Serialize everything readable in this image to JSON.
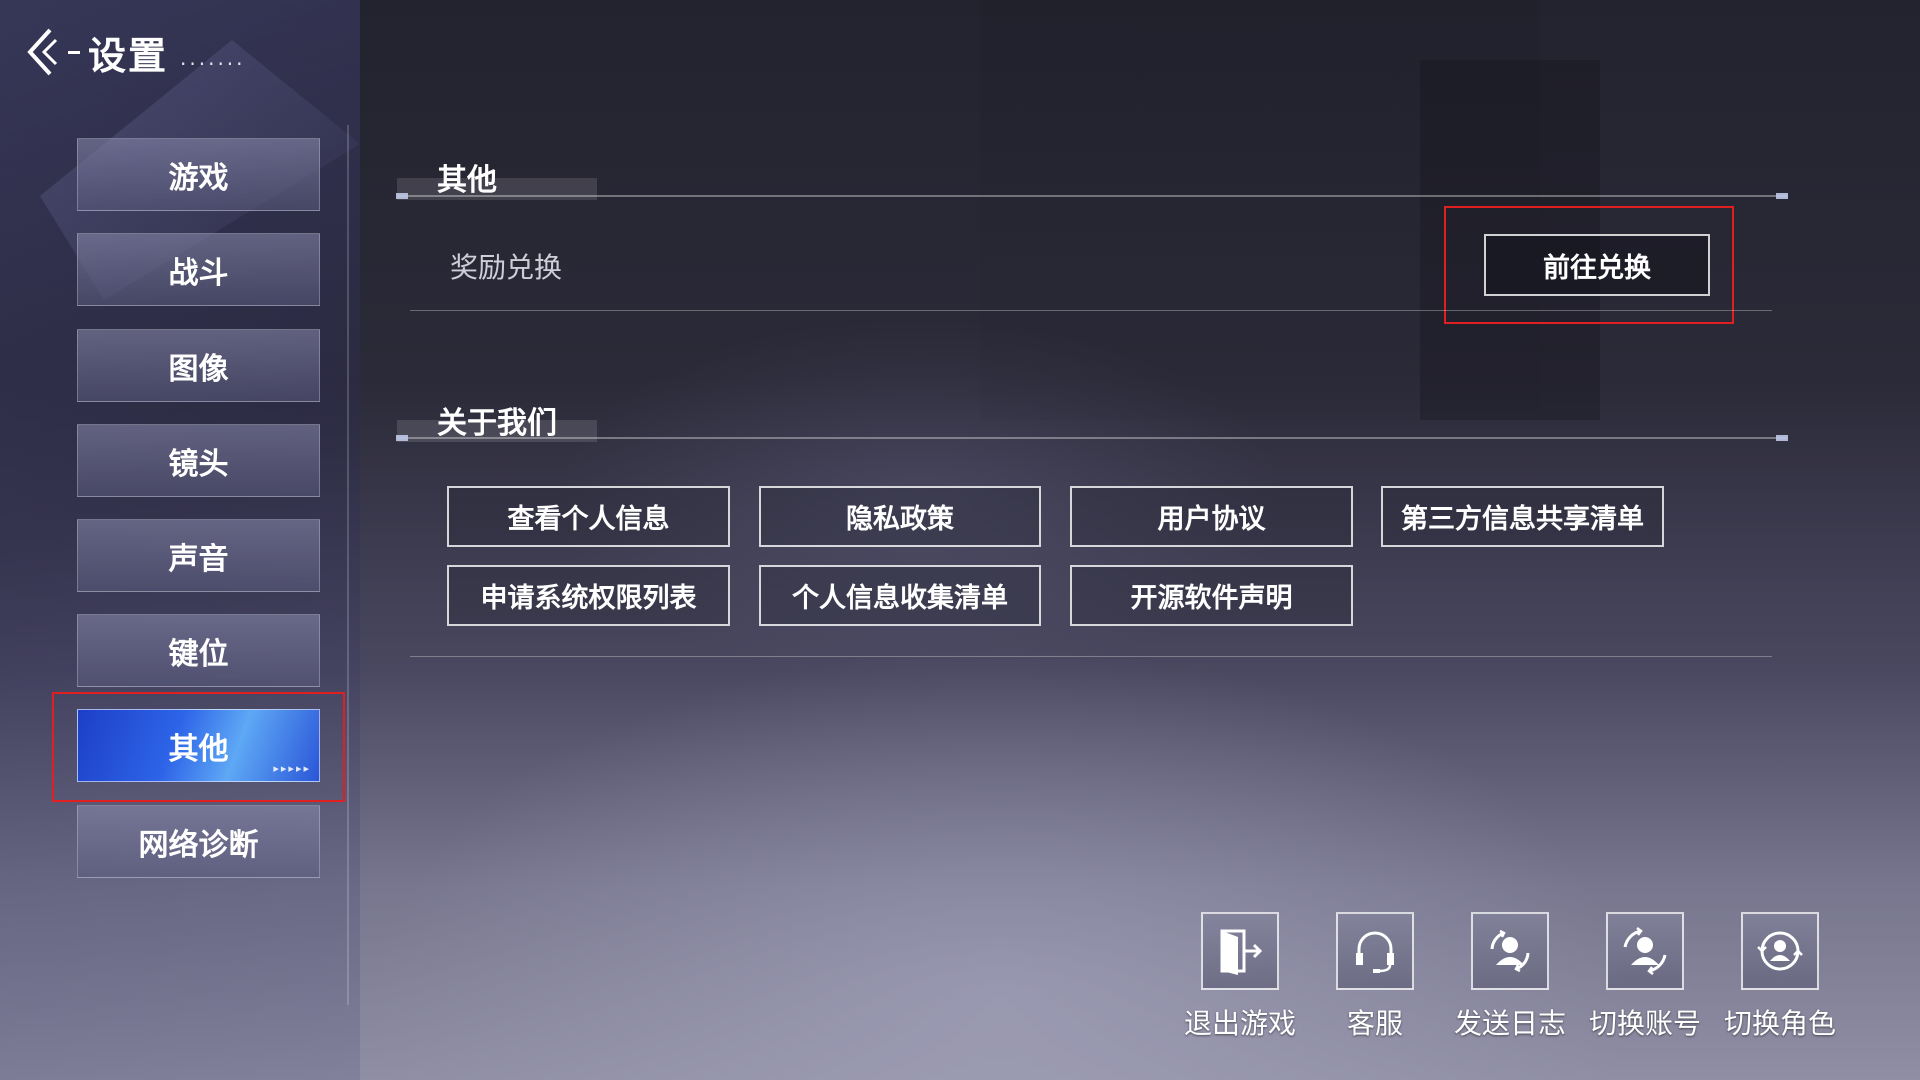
{
  "header": {
    "title": "设置",
    "dots": "......."
  },
  "sidebar": {
    "items": [
      {
        "label": "游戏"
      },
      {
        "label": "战斗"
      },
      {
        "label": "图像"
      },
      {
        "label": "镜头"
      },
      {
        "label": "声音"
      },
      {
        "label": "键位"
      },
      {
        "label": "其他",
        "active": true,
        "arrows": "▸▸▸▸▸"
      },
      {
        "label": "网络诊断"
      }
    ]
  },
  "sections": {
    "other": {
      "title": "其他",
      "reward_label": "奖励兑换",
      "redeem_button": "前往兑换"
    },
    "about": {
      "title": "关于我们",
      "buttons": [
        "查看个人信息",
        "隐私政策",
        "用户协议",
        "第三方信息共享清单",
        "申请系统权限列表",
        "个人信息收集清单",
        "开源软件声明"
      ]
    }
  },
  "actions": [
    {
      "label": "退出游戏",
      "icon": "exit-door-icon"
    },
    {
      "label": "客服",
      "icon": "headset-icon"
    },
    {
      "label": "发送日志",
      "icon": "send-log-icon"
    },
    {
      "label": "切换账号",
      "icon": "switch-account-icon"
    },
    {
      "label": "切换角色",
      "icon": "switch-character-icon"
    }
  ],
  "colors": {
    "active_tab": "#2d64e8",
    "highlight": "#e02020"
  }
}
